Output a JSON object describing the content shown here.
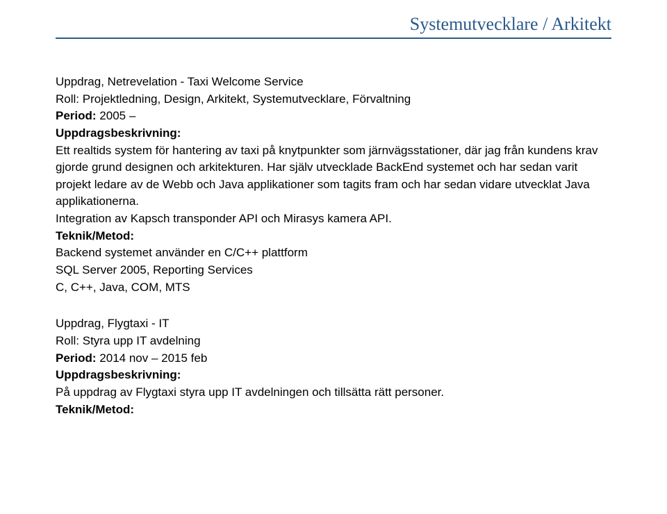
{
  "header": {
    "title": "Systemutvecklare / Arkitekt"
  },
  "assignment1": {
    "prefix": "Uppdrag",
    "comma": ", ",
    "title": "Netrevelation - Taxi Welcome Service",
    "roll_label": "Roll:",
    "roll_value": " Projektledning, Design, Arkitekt, Systemutvecklare, Förvaltning",
    "period_label": "Period:",
    "period_value": " 2005 –",
    "desc_label": "Uppdragsbeskrivning:",
    "desc_body": "Ett realtids system för hantering av taxi på knytpunkter som järnvägsstationer, där jag från kundens krav gjorde grund designen och arkitekturen. Har själv utvecklade BackEnd systemet och har sedan varit projekt ledare av de Webb och Java applikationer som tagits fram och har sedan vidare utvecklat Java applikationerna.",
    "desc_body2": "Integration av Kapsch transponder API och Mirasys kamera API.",
    "tech_label": "Teknik/Metod:",
    "tech_line1": "Backend systemet använder en C/C++ plattform",
    "tech_line2": "SQL Server 2005, Reporting Services",
    "tech_line3": "C, C++, Java, COM, MTS"
  },
  "assignment2": {
    "prefix": "Uppdrag",
    "comma": ",  ",
    "title": "Flygtaxi - IT",
    "roll_label": "Roll:",
    "roll_value": " Styra upp IT avdelning",
    "period_label": "Period:",
    "period_value": " 2014 nov – 2015 feb",
    "desc_label": "Uppdragsbeskrivning:",
    "desc_body": "På uppdrag av Flygtaxi styra upp IT avdelningen och tillsätta rätt personer.",
    "tech_label": "Teknik/Metod:"
  }
}
